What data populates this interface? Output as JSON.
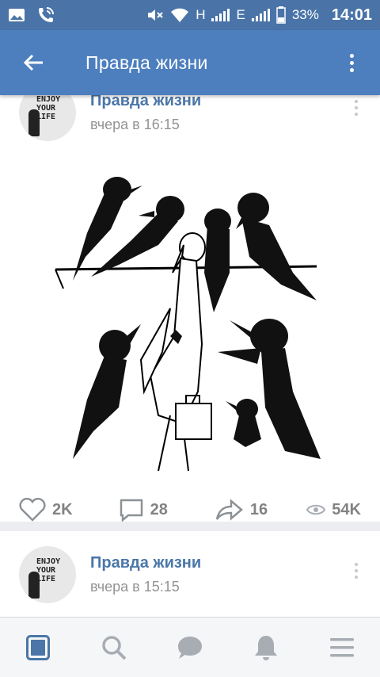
{
  "status_bar": {
    "net_h": "H",
    "net_e": "E",
    "battery": "33%",
    "time": "14:01"
  },
  "app_bar": {
    "title": "Правда жизни"
  },
  "posts": [
    {
      "author": "Правда жизни",
      "date": "вчера в 16:15",
      "avatar_text": "ENJOY YOUR LIFE",
      "likes": "2K",
      "comments": "28",
      "shares": "16",
      "views": "54K"
    },
    {
      "author": "Правда жизни",
      "date": "вчера в 15:15",
      "avatar_text": "ENJOY YOUR LIFE"
    }
  ],
  "bottom_nav": [
    "news-icon",
    "search-icon",
    "messages-icon",
    "notifications-icon",
    "menu-icon"
  ],
  "colors": {
    "status_bar": "#4a74a8",
    "app_bar": "#4d7fbf",
    "link": "#4a76a8",
    "muted": "#939393",
    "active_tab": "#4a76a8",
    "inactive_tab": "#a8adb4"
  }
}
